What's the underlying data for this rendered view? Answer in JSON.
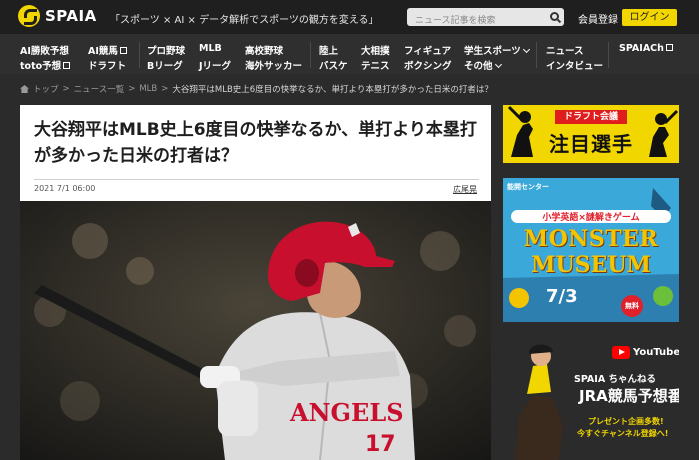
{
  "header": {
    "logo": "SPAIA",
    "tagline": "「スポーツ × AI × データ解析でスポーツの観方を変える」",
    "search_placeholder": "ニュース記事を検索",
    "member": "会員登録",
    "login": "ログイン"
  },
  "nav": {
    "ai_prediction": "AI勝敗予想",
    "toto": "toto予想",
    "ai_keiba": "AI競馬",
    "draft": "ドラフト",
    "pro_baseball": "プロ野球",
    "b_league": "Bリーグ",
    "mlb": "MLB",
    "j_league": "Jリーグ",
    "high_school": "高校野球",
    "overseas_soccer": "海外サッカー",
    "athletics": "陸上",
    "basketball": "バスケ",
    "sumo": "大相撲",
    "tennis": "テニス",
    "figure": "フィギュア",
    "boxing": "ボクシング",
    "student_sports": "学生スポーツ",
    "others": "その他",
    "news": "ニュース",
    "interview": "インタビュー",
    "spaia_ch": "SPAIACh"
  },
  "breadcrumb": {
    "home": "トップ",
    "list": "ニュース一覧",
    "category": "MLB",
    "current": "大谷翔平はMLB史上6度目の快挙なるか、単打より本塁打が多かった日米の打者は？"
  },
  "article": {
    "title": "大谷翔平はMLB史上6度目の快挙なるか、単打より本塁打が多かった日米の打者は？",
    "date": "2021 7/1 06:00",
    "author": "広尾晃"
  },
  "ads": {
    "draft_tag": "ドラフト会議",
    "draft_title": "注目選手",
    "museum_brand": "能開センター",
    "museum_sub": "小学英語×謎解きゲーム",
    "museum_line1": "MONSTER",
    "museum_line2": "MUSEUM",
    "museum_date": "7/3",
    "museum_free": "無料",
    "youtube": "YouTube",
    "ch_name": "SPAIA ちゃんねる",
    "ch_title": "JRA競馬予想番組!",
    "ch_note1": "プレゼント企画多数!",
    "ch_note2": "今すぐチャンネル登録へ!"
  }
}
